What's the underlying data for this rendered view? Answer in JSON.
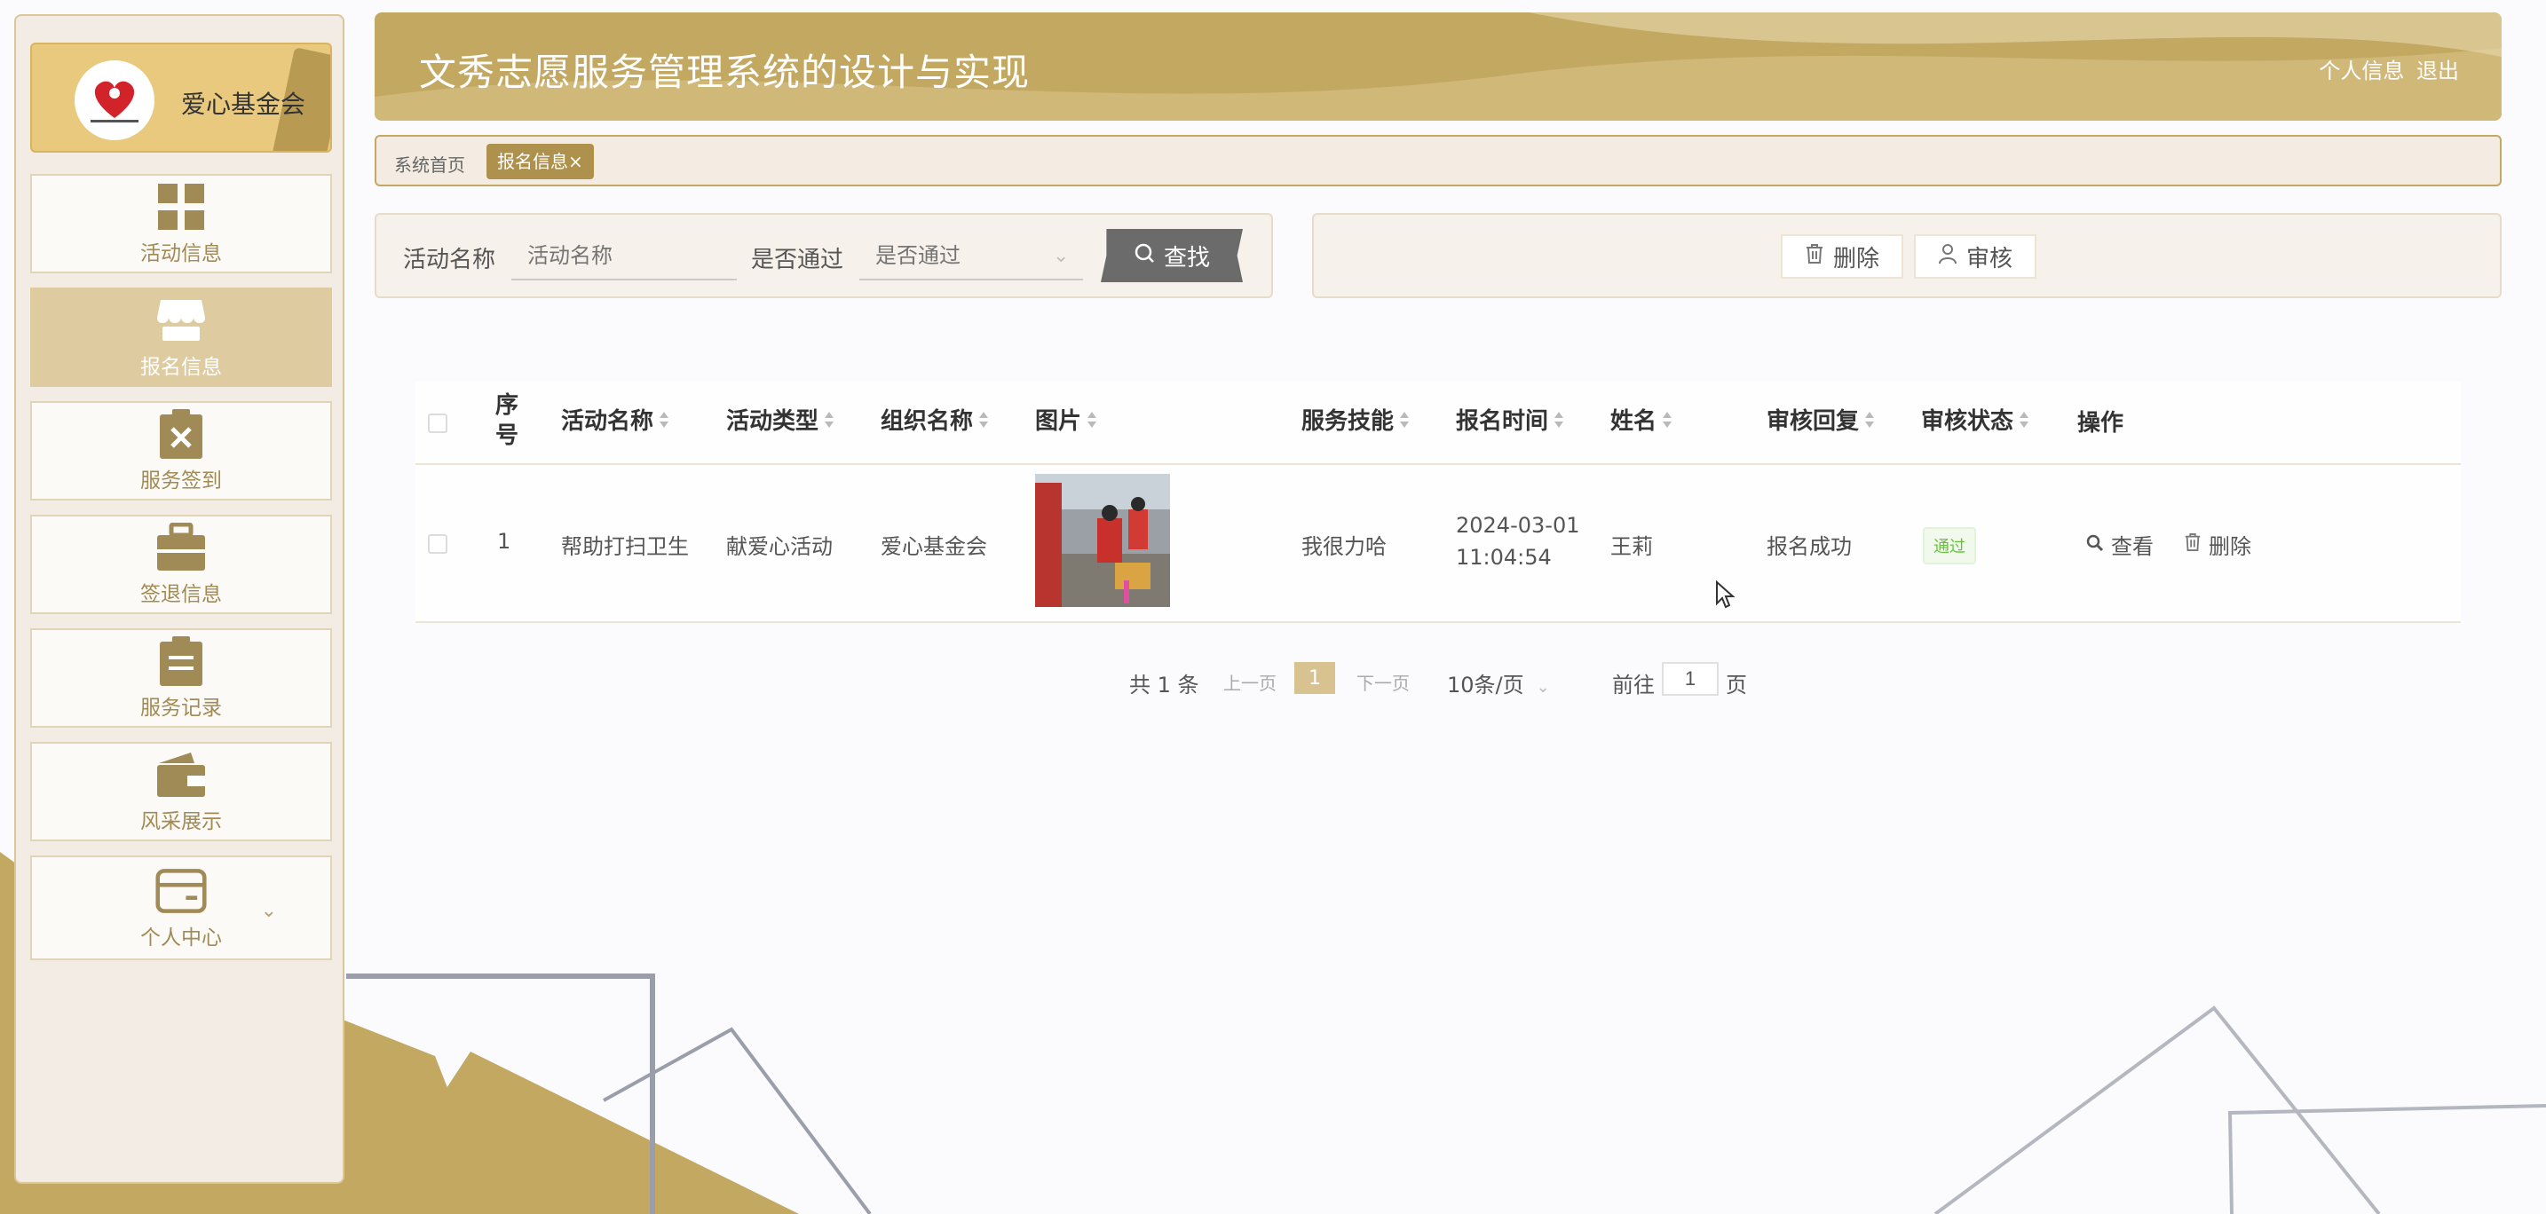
{
  "colors": {
    "accent": "#c3a862",
    "accent_dark": "#ad914c",
    "sidebar_bg": "#f3ece4",
    "active_nav": "#decba0",
    "approved_green": "#67c23a"
  },
  "sidebar": {
    "logo_text": "爱心基金会",
    "items": [
      {
        "label": "活动信息",
        "icon": "grid-icon"
      },
      {
        "label": "报名信息",
        "icon": "storefront-icon",
        "active": true
      },
      {
        "label": "服务签到",
        "icon": "clipboard-x-icon"
      },
      {
        "label": "签退信息",
        "icon": "briefcase-icon"
      },
      {
        "label": "服务记录",
        "icon": "clipboard-list-icon"
      },
      {
        "label": "风采展示",
        "icon": "wallet-icon"
      },
      {
        "label": "个人中心",
        "icon": "card-icon"
      }
    ]
  },
  "header": {
    "title": "文秀志愿服务管理系统的设计与实现",
    "profile_link": "个人信息",
    "logout_link": "退出"
  },
  "tabs": {
    "home": "系统首页",
    "active": "报名信息",
    "close_glyph": "×"
  },
  "search": {
    "activity_label": "活动名称",
    "activity_placeholder": "活动名称",
    "pass_label": "是否通过",
    "pass_placeholder": "是否通过",
    "find_button": "查找"
  },
  "actions": {
    "delete": "删除",
    "review": "审核"
  },
  "table": {
    "columns": [
      "序号",
      "活动名称",
      "活动类型",
      "组织名称",
      "图片",
      "服务技能",
      "报名时间",
      "姓名",
      "审核回复",
      "审核状态",
      "操作"
    ],
    "rows": [
      {
        "index": "1",
        "activity_name": "帮助打扫卫生",
        "activity_type": "献爱心活动",
        "org_name": "爱心基金会",
        "skill": "我很力哈",
        "signup_date": "2024-03-01",
        "signup_time": "11:04:54",
        "name": "王莉",
        "review_reply": "报名成功",
        "review_status": "通过",
        "view_action": "查看",
        "delete_action": "删除"
      }
    ]
  },
  "pagination": {
    "total": "共 1 条",
    "prev": "上一页",
    "current_page": "1",
    "next": "下一页",
    "page_size": "10条/页",
    "goto_label": "前往",
    "goto_value": "1",
    "page_suffix": "页"
  }
}
